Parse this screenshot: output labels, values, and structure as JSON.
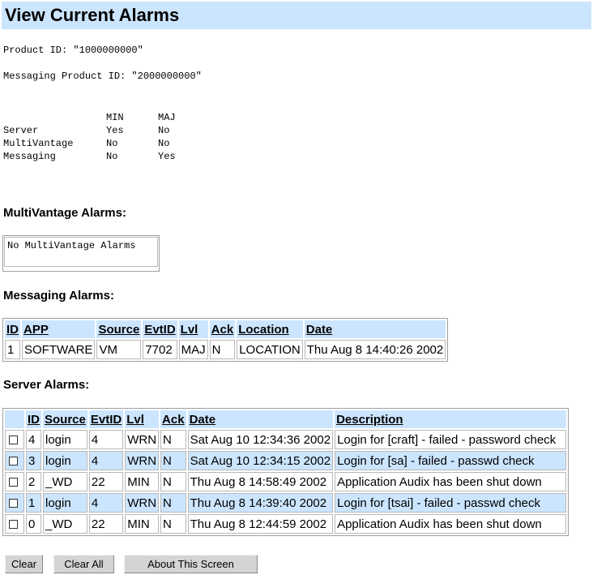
{
  "page": {
    "title": "View Current Alarms"
  },
  "product": {
    "product_id_line": "Product ID: \"1000000000\"",
    "messaging_id_line": "Messaging Product ID: \"2000000000\""
  },
  "status_table": {
    "headers": [
      "MIN",
      "MAJ"
    ],
    "rows": [
      {
        "name": "Server",
        "min": "Yes",
        "maj": "No"
      },
      {
        "name": "MultiVantage",
        "min": "No",
        "maj": "No"
      },
      {
        "name": "Messaging",
        "min": "No",
        "maj": "Yes"
      }
    ]
  },
  "multivantage": {
    "heading": "MultiVantage Alarms:",
    "empty_text": "No MultiVantage Alarms"
  },
  "messaging": {
    "heading": "Messaging Alarms:",
    "columns": [
      "ID",
      "APP",
      "Source",
      "EvtID",
      "Lvl",
      "Ack",
      "Location",
      "Date"
    ],
    "rows": [
      {
        "id": "1",
        "app": "SOFTWARE",
        "source": "VM",
        "evtid": "7702",
        "lvl": "MAJ",
        "ack": "N",
        "location": "LOCATION",
        "date": "Thu Aug 8 14:40:26 2002"
      }
    ]
  },
  "server": {
    "heading": "Server Alarms:",
    "columns": [
      "ID",
      "Source",
      "EvtID",
      "Lvl",
      "Ack",
      "Date",
      "Description"
    ],
    "rows": [
      {
        "id": "4",
        "source": "login",
        "evtid": "4",
        "lvl": "WRN",
        "ack": "N",
        "date": "Sat Aug 10 12:34:36 2002",
        "description": "Login for [craft] - failed - password check"
      },
      {
        "id": "3",
        "source": "login",
        "evtid": "4",
        "lvl": "WRN",
        "ack": "N",
        "date": "Sat Aug 10 12:34:15 2002",
        "description": "Login for [sa] - failed - passwd check"
      },
      {
        "id": "2",
        "source": "_WD",
        "evtid": "22",
        "lvl": "MIN",
        "ack": "N",
        "date": "Thu Aug 8 14:58:49 2002",
        "description": "Application Audix has been shut down"
      },
      {
        "id": "1",
        "source": "login",
        "evtid": "4",
        "lvl": "WRN",
        "ack": "N",
        "date": "Thu Aug 8 14:39:40 2002",
        "description": "Login for [tsai] - failed - passwd check"
      },
      {
        "id": "0",
        "source": "_WD",
        "evtid": "22",
        "lvl": "MIN",
        "ack": "N",
        "date": "Thu Aug 8 12:44:59 2002",
        "description": "Application Audix has been shut down"
      }
    ]
  },
  "buttons": {
    "clear": "Clear",
    "clear_all": "Clear All",
    "about": "About This Screen"
  },
  "colors": {
    "header_bg": "#cce5ff",
    "button_bg": "#d4d4d4"
  }
}
